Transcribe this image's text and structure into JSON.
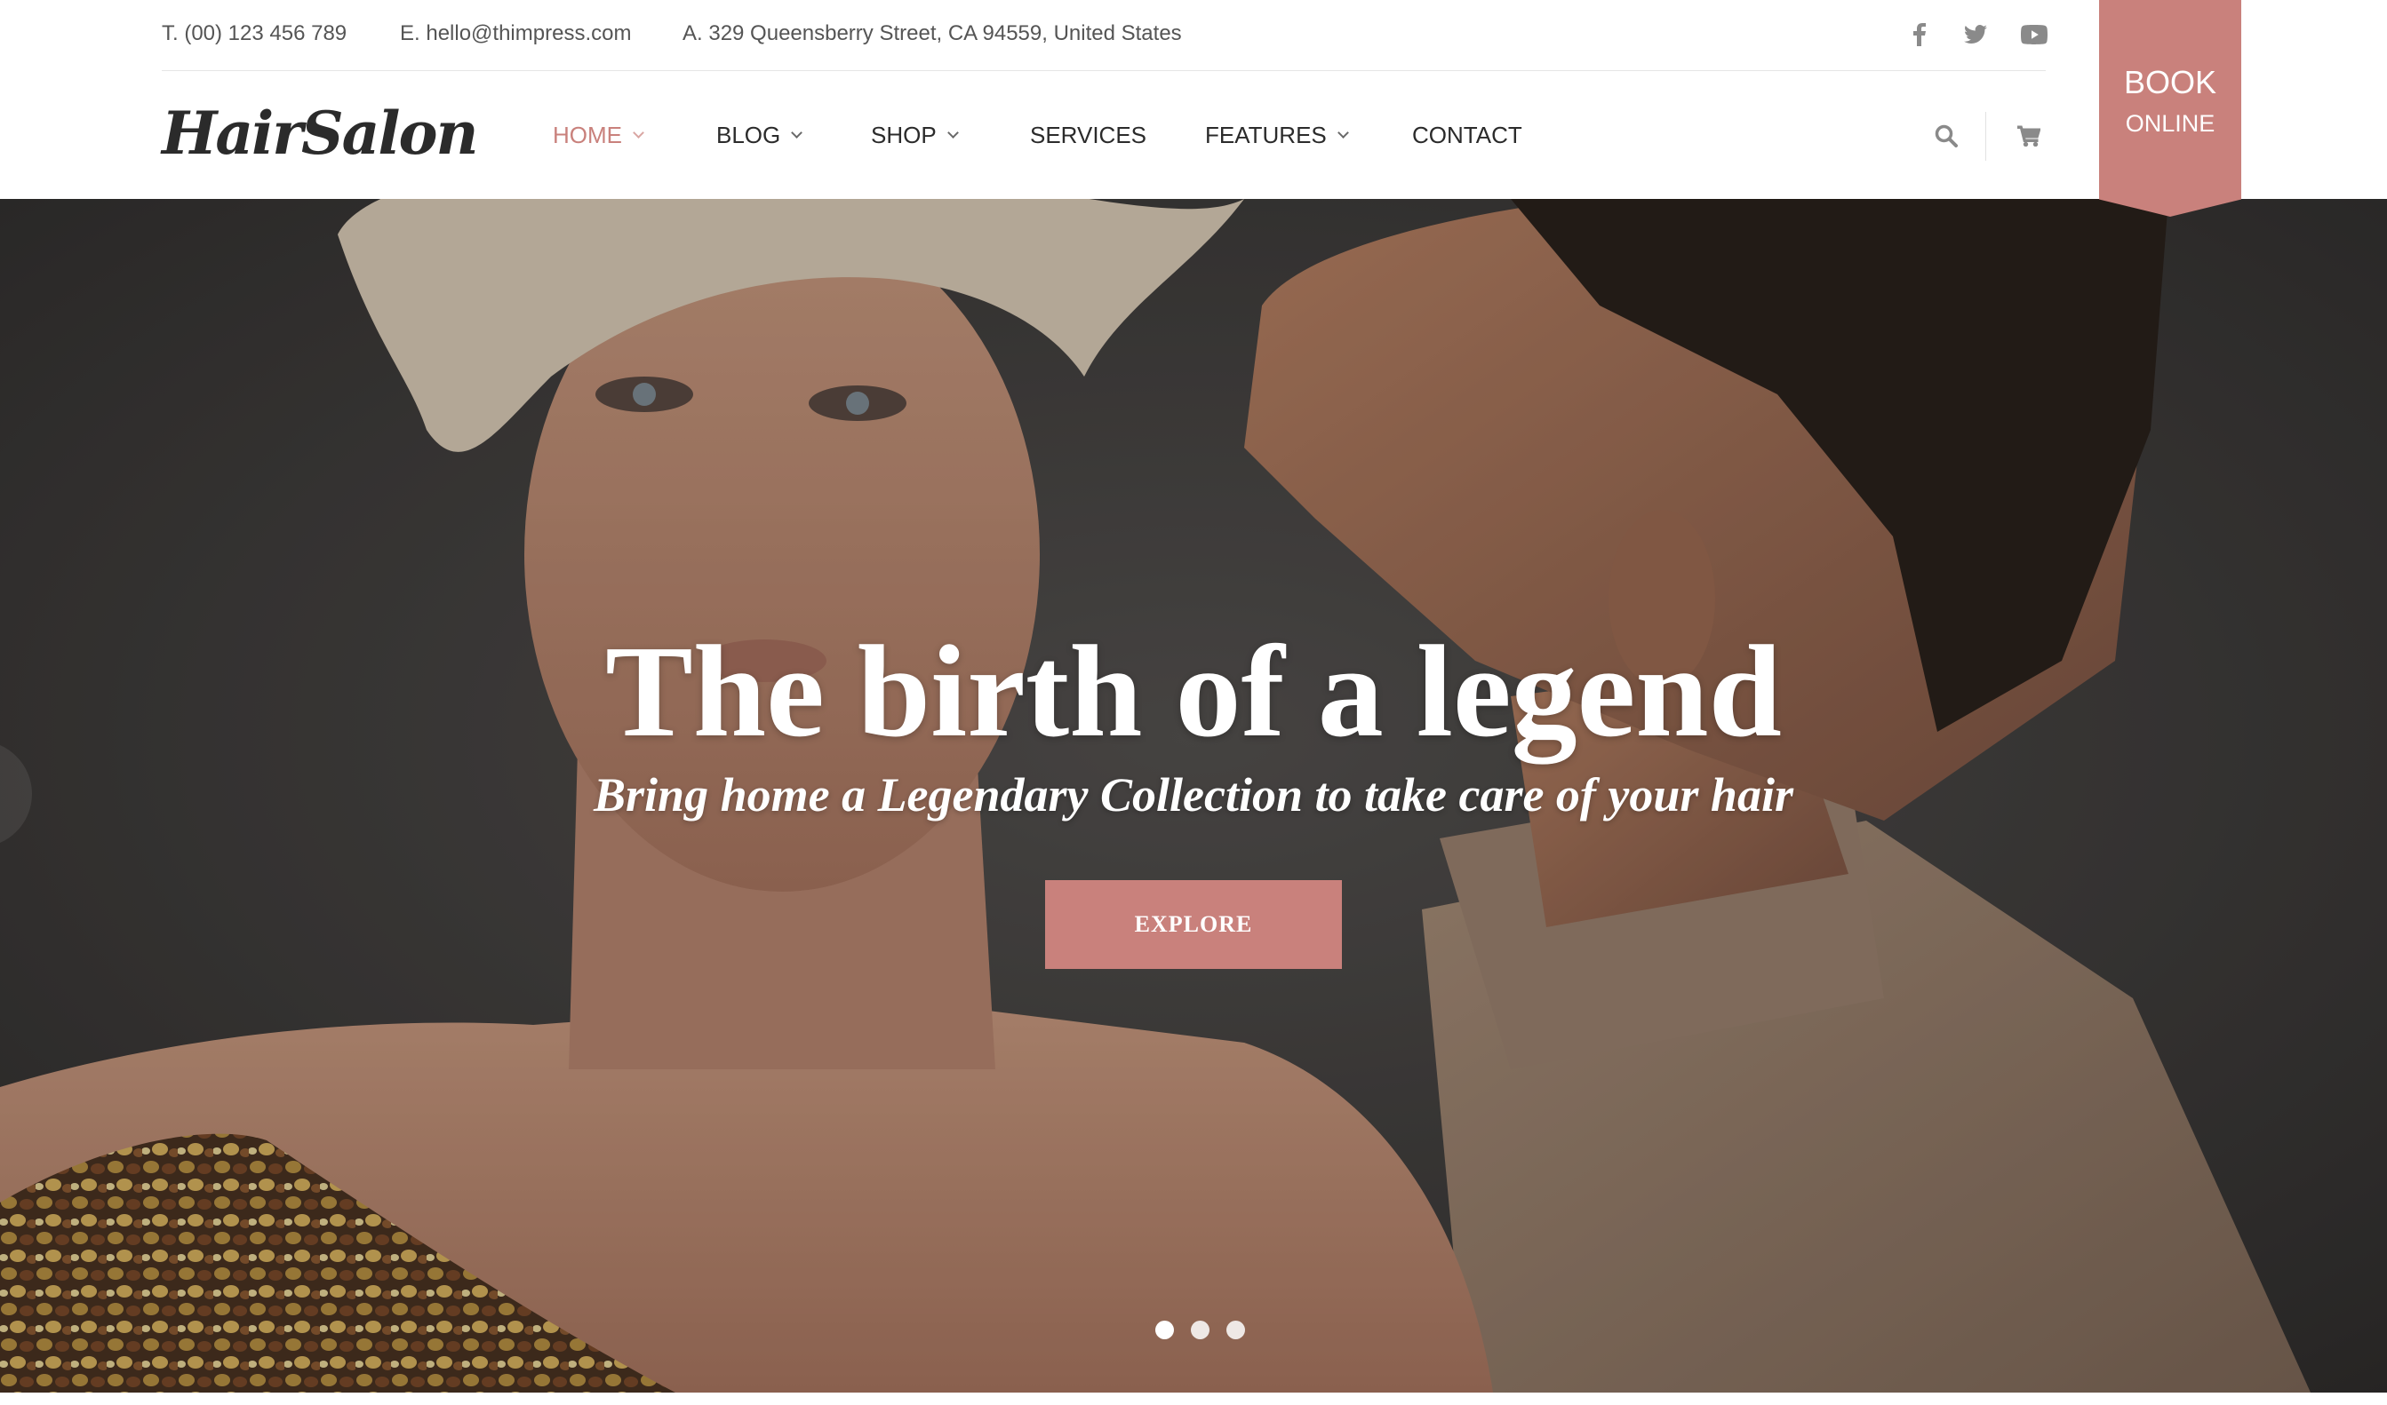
{
  "topbar": {
    "phone": "T. (00) 123 456 789",
    "email": "E. hello@thimpress.com",
    "address": "A. 329 Queensberry Street, CA 94559, United States",
    "social": [
      "facebook-icon",
      "twitter-icon",
      "youtube-icon"
    ]
  },
  "logo": "HairSalon",
  "nav": {
    "items": [
      {
        "label": "HOME",
        "dropdown": true,
        "active": true
      },
      {
        "label": "BLOG",
        "dropdown": true
      },
      {
        "label": "SHOP",
        "dropdown": true
      },
      {
        "label": "SERVICES",
        "dropdown": false
      },
      {
        "label": "FEATURES",
        "dropdown": true
      },
      {
        "label": "CONTACT",
        "dropdown": false
      }
    ],
    "tools": [
      "search-icon",
      "cart-icon"
    ]
  },
  "book": {
    "line1": "BOOK",
    "line2": "ONLINE"
  },
  "hero": {
    "title": "The birth of a legend",
    "subtitle": "Bring home a Legendary Collection to take care of your hair",
    "button": "EXPLORE",
    "slides": 3,
    "active_slide": 1
  },
  "colors": {
    "accent": "#c9817c",
    "text": "#2b2b2b",
    "muted": "#555555",
    "icon": "#8a8a8a",
    "hero_bg": "#3b3836"
  }
}
